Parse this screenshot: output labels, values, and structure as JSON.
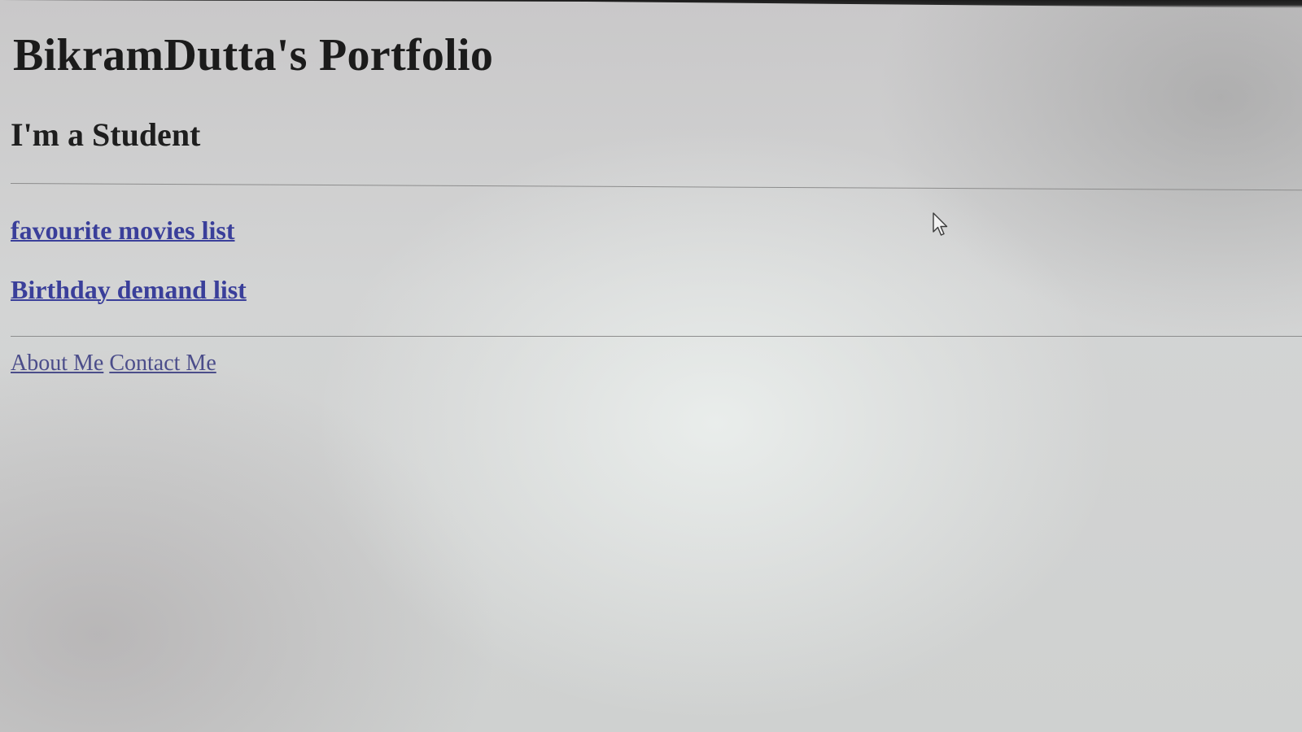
{
  "page": {
    "title": "BikramDutta's Portfolio",
    "subtitle": "I'm a Student"
  },
  "links": [
    {
      "label": "favourite movies list"
    },
    {
      "label": "Birthday demand list"
    }
  ],
  "footer": {
    "links": [
      {
        "label": "About Me"
      },
      {
        "label": "Contact Me"
      }
    ]
  },
  "colors": {
    "link": "#3a3f9a",
    "text": "#1b1b1b",
    "background": "#d0d1d1"
  },
  "icons": {
    "cursor": "mouse-pointer-icon"
  }
}
